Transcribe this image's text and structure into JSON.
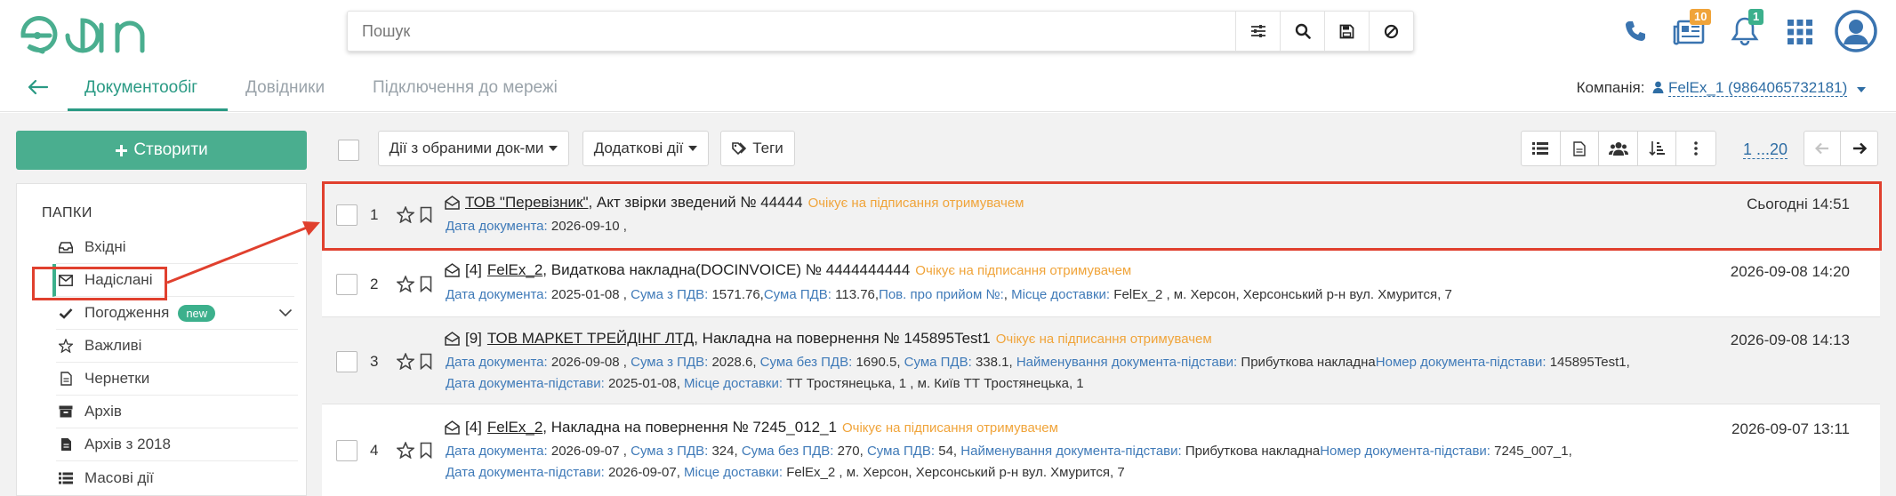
{
  "header": {
    "logo_text": "edin",
    "search_placeholder": "Пошук",
    "news_count": "10",
    "notif_count": "1"
  },
  "subnav": {
    "tabs": [
      {
        "label": "Документообіг",
        "active": true
      },
      {
        "label": "Довідники",
        "active": false
      },
      {
        "label": "Підключення до мережі",
        "active": false
      }
    ],
    "company_label": "Компанія:",
    "company_value": "FelEx_1 (9864065732181)"
  },
  "sidebar": {
    "create_label": "Створити",
    "folders_title": "ПАПКИ",
    "items": [
      {
        "label": "Вхідні",
        "icon": "inbox-icon"
      },
      {
        "label": "Надіслані",
        "icon": "envelope-icon",
        "active": true
      },
      {
        "label": "Погодження",
        "icon": "check-icon",
        "badge": "new"
      },
      {
        "label": "Важливі",
        "icon": "star-icon"
      },
      {
        "label": "Чернетки",
        "icon": "file-icon"
      },
      {
        "label": "Архів",
        "icon": "archive-icon"
      },
      {
        "label": "Архів з 2018",
        "icon": "file-text-icon"
      },
      {
        "label": "Масові дії",
        "icon": "list-icon"
      }
    ]
  },
  "toolbar": {
    "bulk_actions": "Дії з обраними док-ми",
    "extra_actions": "Додаткові дії",
    "tags": "Теги",
    "pager": "1 ...20"
  },
  "documents": [
    {
      "num": "1",
      "counter": "",
      "org": "ТОВ \"Перевізник\"",
      "title": ", Акт звірки зведений № 44444",
      "status": "Очікує на підписання отримувачем",
      "date": "Сьогодні 14:51",
      "line2": [
        {
          "l": "Дата документа:",
          "v": "2026-09-10 ,"
        }
      ],
      "line3": []
    },
    {
      "num": "2",
      "counter": "[4]",
      "org": "FelEx_2",
      "title": ", Видаткова накладна(DOCINVOICE) № 4444444444",
      "status": "Очікує на підписання отримувачем",
      "date": "2026-09-08 14:20",
      "line2": [
        {
          "l": "Дата документа:",
          "v": "2025-01-08 ,"
        },
        {
          "l": "Сума з ПДВ:",
          "v": "1571.76,"
        },
        {
          "l": "Сума ПДВ:",
          "v": "113.76,"
        },
        {
          "l": "Пов. про прийом №:",
          "v": ","
        },
        {
          "l": "Місце доставки:",
          "v": "FelEx_2 , м. Херсон, Херсонський р-н вул. Хмурится, 7"
        }
      ],
      "line3": []
    },
    {
      "num": "3",
      "counter": "[9]",
      "org": "ТОВ МАРКЕТ ТРЕЙДІНГ ЛТД",
      "title": ", Накладна на повернення № 145895Test1",
      "status": "Очікує на підписання отримувачем",
      "date": "2026-09-08 14:13",
      "line2": [
        {
          "l": "Дата документа:",
          "v": "2026-09-08 ,"
        },
        {
          "l": "Сума з ПДВ:",
          "v": "2028.6,"
        },
        {
          "l": "Сума без ПДВ:",
          "v": "1690.5,"
        },
        {
          "l": "Сума ПДВ:",
          "v": "338.1,"
        },
        {
          "l": "Найменування документа-підстави:",
          "v": "Прибуткова накладна"
        },
        {
          "l": "Номер документа-підстави:",
          "v": "145895Test1,"
        }
      ],
      "line3": [
        {
          "l": "Дата документа-підстави:",
          "v": "2025-01-08,"
        },
        {
          "l": "Місце доставки:",
          "v": "ТТ Тростянецька, 1 , м. Київ ТТ Тростянецька, 1"
        }
      ]
    },
    {
      "num": "4",
      "counter": "[4]",
      "org": "FelEx_2",
      "title": ", Накладна на повернення № 7245_012_1",
      "status": "Очікує на підписання отримувачем",
      "date": "2026-09-07 13:11",
      "line2": [
        {
          "l": "Дата документа:",
          "v": "2026-09-07 ,"
        },
        {
          "l": "Сума з ПДВ:",
          "v": "324,"
        },
        {
          "l": "Сума без ПДВ:",
          "v": "270,"
        },
        {
          "l": "Сума ПДВ:",
          "v": "54,"
        },
        {
          "l": "Найменування документа-підстави:",
          "v": "Прибуткова накладна"
        },
        {
          "l": "Номер документа-підстави:",
          "v": "7245_007_1,"
        }
      ],
      "line3": [
        {
          "l": "Дата документа-підстави:",
          "v": "2026-09-07,"
        },
        {
          "l": "Місце доставки:",
          "v": "FelEx_2 , м. Херсон, Херсонський р-н вул. Хмурится, 7"
        }
      ]
    }
  ]
}
